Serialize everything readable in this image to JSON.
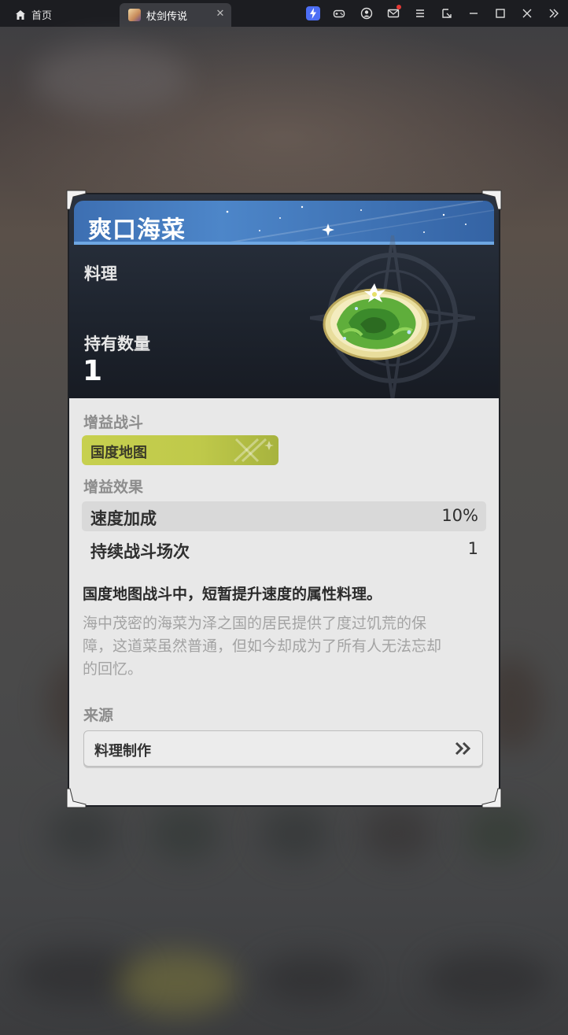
{
  "titlebar": {
    "home_label": "首页",
    "tab_label": "杖剑传说",
    "close_tab_glyph": "✕"
  },
  "item": {
    "title": "爽口海菜",
    "category": "料理",
    "owned_label": "持有数量",
    "owned_value": "1",
    "buff_battle_label": "增益战斗",
    "buff_battle_value": "国度地图",
    "buff_effect_label": "增益效果",
    "stats": [
      {
        "name": "速度加成",
        "value": "10%"
      },
      {
        "name": "持续战斗场次",
        "value": "1"
      }
    ],
    "summary": "国度地图战斗中，短暂提升速度的属性料理。",
    "flavor_lines": [
      "海中茂密的海菜为泽之国的居民提供了度过饥荒的保",
      "障，这道菜虽然普通，但如今却成为了所有人无法忘却",
      "的回忆。"
    ],
    "source_label": "来源",
    "source_button": "料理制作"
  },
  "icons": [
    "home-icon",
    "boost-icon",
    "gamepad-icon",
    "account-icon",
    "mail-icon",
    "menu-icon",
    "screenshot-icon",
    "minimize-icon",
    "maximize-icon",
    "close-icon",
    "collapse-icon",
    "seaweed-dish-icon",
    "double-chevron-icon"
  ],
  "colors": {
    "title_band": "#4d86c9",
    "tag_yellow": "#c7d04f",
    "titlebar_bg": "#1c1d21",
    "card_bg": "#e8e8e8"
  }
}
